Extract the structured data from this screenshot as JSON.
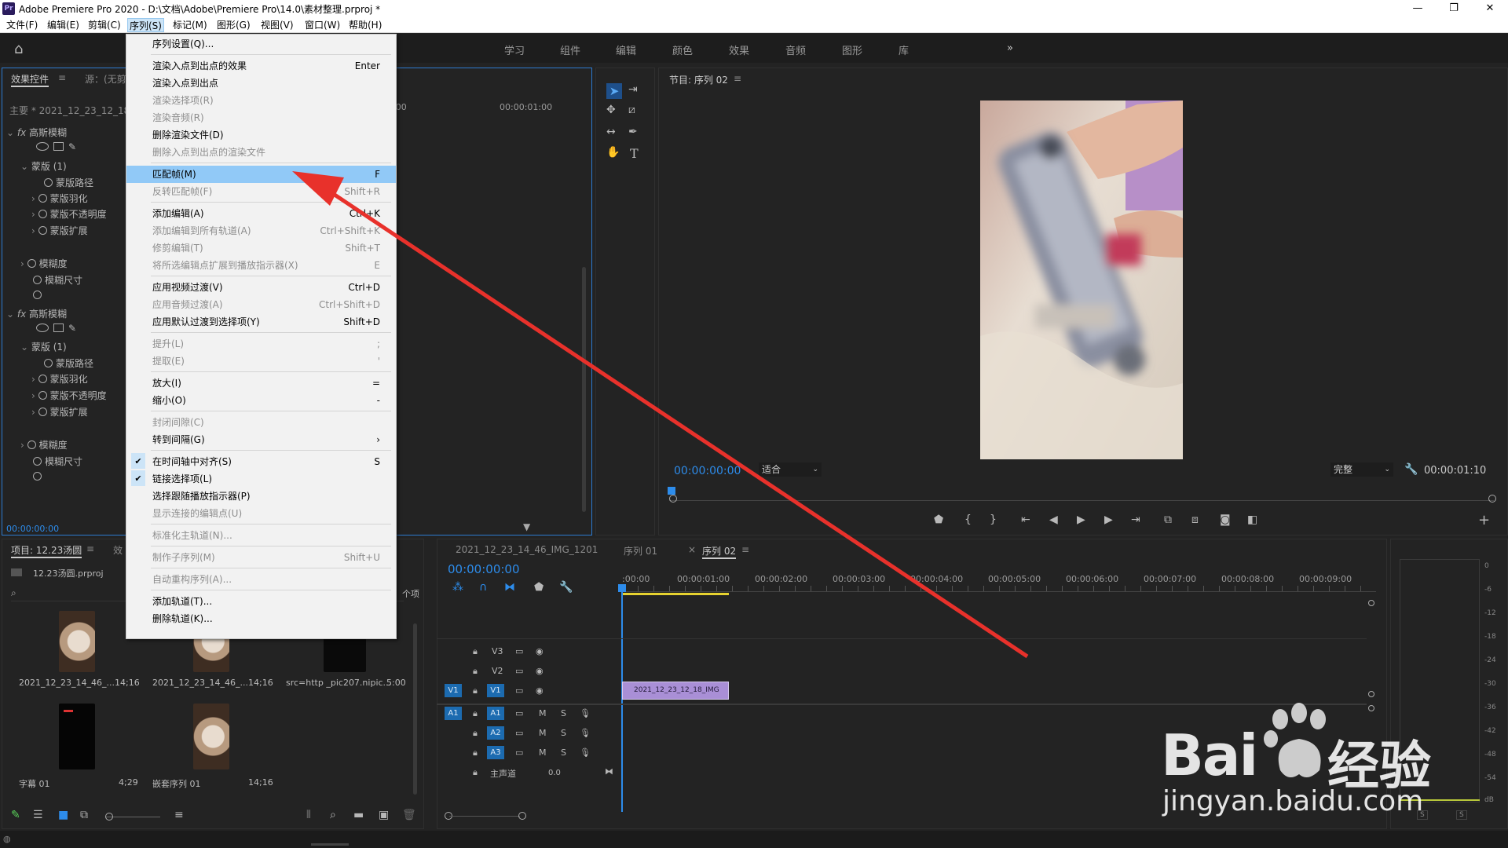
{
  "window": {
    "app_icon": "Pr",
    "title": "Adobe Premiere Pro 2020 - D:\\文档\\Adobe\\Premiere Pro\\14.0\\素材整理.prproj *",
    "minimize": "—",
    "maximize": "❐",
    "close": "✕"
  },
  "menubar": [
    "文件(F)",
    "编辑(E)",
    "剪辑(C)",
    "序列(S)",
    "标记(M)",
    "图形(G)",
    "视图(V)",
    "窗口(W)",
    "帮助(H)"
  ],
  "workspaces": [
    "学习",
    "组件",
    "编辑",
    "颜色",
    "效果",
    "音频",
    "图形",
    "库",
    "»"
  ],
  "effect_controls": {
    "tab": "效果控件",
    "source_tab": "源：(无剪",
    "master_clip": "主要 * 2021_12_23_12_18_",
    "tree": [
      "高斯模糊",
      "蒙版 (1)",
      "蒙版路径",
      "蒙版羽化",
      "蒙版不透明度",
      "蒙版扩展",
      "模糊度",
      "模糊尺寸",
      "高斯模糊",
      "蒙版 (1)",
      "蒙版路径",
      "蒙版羽化",
      "蒙版不透明度",
      "蒙版扩展",
      "模糊度",
      "模糊尺寸"
    ],
    "fx_label": "fx",
    "timecode": "00:00:00:00",
    "mini_ruler": [
      ":00",
      "00:00:01:00"
    ]
  },
  "sequence_menu": [
    {
      "label": "序列设置(Q)...",
      "shortcut": "",
      "enabled": true
    },
    {
      "sep": true
    },
    {
      "label": "渲染入点到出点的效果",
      "shortcut": "Enter",
      "enabled": true
    },
    {
      "label": "渲染入点到出点",
      "shortcut": "",
      "enabled": true
    },
    {
      "label": "渲染选择项(R)",
      "shortcut": "",
      "enabled": false
    },
    {
      "label": "渲染音频(R)",
      "shortcut": "",
      "enabled": false
    },
    {
      "label": "删除渲染文件(D)",
      "shortcut": "",
      "enabled": true
    },
    {
      "label": "删除入点到出点的渲染文件",
      "shortcut": "",
      "enabled": false
    },
    {
      "sep": true
    },
    {
      "label": "匹配帧(M)",
      "shortcut": "F",
      "enabled": true,
      "highlight": true
    },
    {
      "label": "反转匹配帧(F)",
      "shortcut": "Shift+R",
      "enabled": false
    },
    {
      "sep": true
    },
    {
      "label": "添加编辑(A)",
      "shortcut": "Ctrl+K",
      "enabled": true
    },
    {
      "label": "添加编辑到所有轨道(A)",
      "shortcut": "Ctrl+Shift+K",
      "enabled": false
    },
    {
      "label": "修剪编辑(T)",
      "shortcut": "Shift+T",
      "enabled": false
    },
    {
      "label": "将所选编辑点扩展到播放指示器(X)",
      "shortcut": "E",
      "enabled": false
    },
    {
      "sep": true
    },
    {
      "label": "应用视频过渡(V)",
      "shortcut": "Ctrl+D",
      "enabled": true
    },
    {
      "label": "应用音频过渡(A)",
      "shortcut": "Ctrl+Shift+D",
      "enabled": false
    },
    {
      "label": "应用默认过渡到选择项(Y)",
      "shortcut": "Shift+D",
      "enabled": true
    },
    {
      "sep": true
    },
    {
      "label": "提升(L)",
      "shortcut": ";",
      "enabled": false
    },
    {
      "label": "提取(E)",
      "shortcut": "'",
      "enabled": false
    },
    {
      "sep": true
    },
    {
      "label": "放大(I)",
      "shortcut": "=",
      "enabled": true
    },
    {
      "label": "缩小(O)",
      "shortcut": "-",
      "enabled": true
    },
    {
      "sep": true
    },
    {
      "label": "封闭间隙(C)",
      "shortcut": "",
      "enabled": false
    },
    {
      "label": "转到间隔(G)",
      "shortcut": "›",
      "enabled": true
    },
    {
      "sep": true
    },
    {
      "label": "在时间轴中对齐(S)",
      "shortcut": "S",
      "enabled": true,
      "checked": true
    },
    {
      "label": "链接选择项(L)",
      "shortcut": "",
      "enabled": true,
      "checked": true
    },
    {
      "label": "选择跟随播放指示器(P)",
      "shortcut": "",
      "enabled": true
    },
    {
      "label": "显示连接的编辑点(U)",
      "shortcut": "",
      "enabled": false
    },
    {
      "sep": true
    },
    {
      "label": "标准化主轨道(N)...",
      "shortcut": "",
      "enabled": false
    },
    {
      "sep": true
    },
    {
      "label": "制作子序列(M)",
      "shortcut": "Shift+U",
      "enabled": false
    },
    {
      "sep": true
    },
    {
      "label": "自动重构序列(A)...",
      "shortcut": "",
      "enabled": false
    },
    {
      "sep": true
    },
    {
      "label": "添加轨道(T)...",
      "shortcut": "",
      "enabled": true
    },
    {
      "label": "删除轨道(K)...",
      "shortcut": "",
      "enabled": true
    }
  ],
  "program_monitor": {
    "title": "节目: 序列 02",
    "timecode": "00:00:00:00",
    "fit": "适合",
    "quality": "完整",
    "duration": "00:00:01:10",
    "buttons": [
      "marker-icon",
      "in-point-icon",
      "out-point-icon",
      "go-to-in-icon",
      "step-back-icon",
      "play-icon",
      "step-forward-icon",
      "go-to-out-icon",
      "insert-icon",
      "overwrite-icon",
      "export-frame-icon",
      "compare-icon"
    ],
    "add": "+"
  },
  "project_panel": {
    "tab": "项目: 12.23汤圆",
    "tab2": "效",
    "file": "12.23汤圆.prproj",
    "count_suffix": "个项",
    "items": [
      {
        "name": "2021_12_23_14_46_...",
        "duration": "14;16"
      },
      {
        "name": "2021_12_23_14_46_...",
        "duration": "14;16"
      },
      {
        "name": "src=http _pic207.nipic...",
        "duration": "5:00"
      },
      {
        "name": "字幕 01",
        "duration": "4;29"
      },
      {
        "name": "嵌套序列 01",
        "duration": "14;16"
      }
    ]
  },
  "timeline": {
    "tabs": [
      "2021_12_23_14_46_IMG_1201",
      "序列 01",
      "序列 02"
    ],
    "active_tab_close": "×",
    "timecode": "00:00:00:00",
    "ruler": [
      ":00:00",
      "00:00:01:00",
      "00:00:02:00",
      "00:00:03:00",
      "00:00:04:00",
      "00:00:05:00",
      "00:00:06:00",
      "00:00:07:00",
      "00:00:08:00",
      "00:00:09:00"
    ],
    "video_tracks": [
      "V3",
      "V2",
      "V1"
    ],
    "audio_tracks": [
      "A1",
      "A2",
      "A3"
    ],
    "source_v": "V1",
    "source_a": "A1",
    "mix_label": "主声道",
    "mix_value": "0.0",
    "clip_label": "2021_12_23_12_18_IMG",
    "m": "M",
    "s": "S"
  },
  "meters": {
    "scale": [
      "0",
      "-6",
      "-12",
      "-18",
      "-24",
      "-30",
      "-36",
      "-42",
      "-48",
      "-54",
      "dB"
    ],
    "solo": [
      "S",
      "S"
    ]
  },
  "watermark": {
    "brand": "Bai",
    "brand2": "经验",
    "url": "jingyan.baidu.com"
  },
  "colors": {
    "accent_blue": "#2d8ceb",
    "highlight": "#91c9f7",
    "clip_purple": "#a98fd6",
    "arrow_red": "#e8312b"
  }
}
